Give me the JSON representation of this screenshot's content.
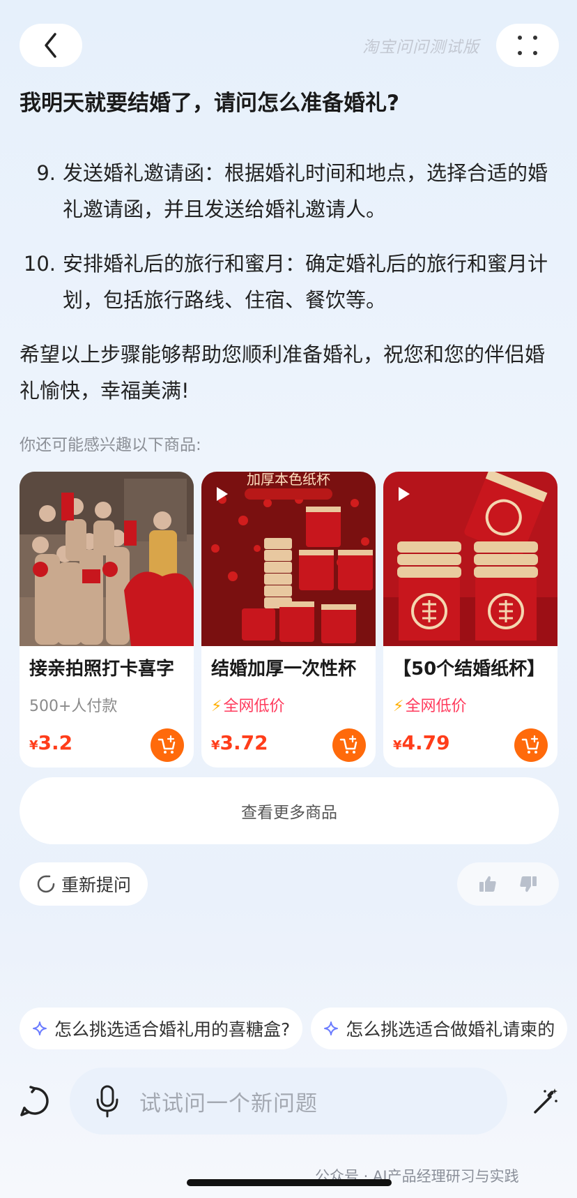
{
  "header": {
    "app_title": "淘宝问问测试版"
  },
  "question": "我明天就要结婚了，请问怎么准备婚礼?",
  "answer": {
    "steps": [
      {
        "num": "9.",
        "text": "发送婚礼邀请函：根据婚礼时间和地点，选择合适的婚礼邀请函，并且发送给婚礼邀请人。"
      },
      {
        "num": "10.",
        "text": "安排婚礼后的旅行和蜜月：确定婚礼后的旅行和蜜月计划，包括旅行路线、住宿、餐饮等。"
      }
    ],
    "closing": "希望以上步骤能够帮助您顺利准备婚礼，祝您和您的伴侣婚礼愉快，幸福美满!"
  },
  "recommend_label": "你还可能感兴趣以下商品:",
  "products": [
    {
      "title": "接亲拍照打卡喜字",
      "subtitle": "500+人付款",
      "currency": "¥",
      "price": "3.2"
    },
    {
      "title": "结婚加厚一次性杯",
      "subtitle": "全网低价",
      "currency": "¥",
      "price": "3.72",
      "img_text": "加厚本色纸杯"
    },
    {
      "title": "【50个结婚纸杯】",
      "subtitle": "全网低价",
      "currency": "¥",
      "price": "4.79"
    }
  ],
  "more_products_label": "查看更多商品",
  "retry_label": "重新提问",
  "suggestions": [
    "怎么挑选适合婚礼用的喜糖盒?",
    "怎么挑选适合做婚礼请柬的"
  ],
  "input": {
    "placeholder": "试试问一个新问题"
  },
  "watermark": "公众号 · AI产品经理研习与实践",
  "colors": {
    "accent_orange": "#ff6a0b",
    "price_red": "#ff3d1a",
    "promo_pink": "#ff3a5c",
    "lightning_yellow": "#ffaf00"
  }
}
